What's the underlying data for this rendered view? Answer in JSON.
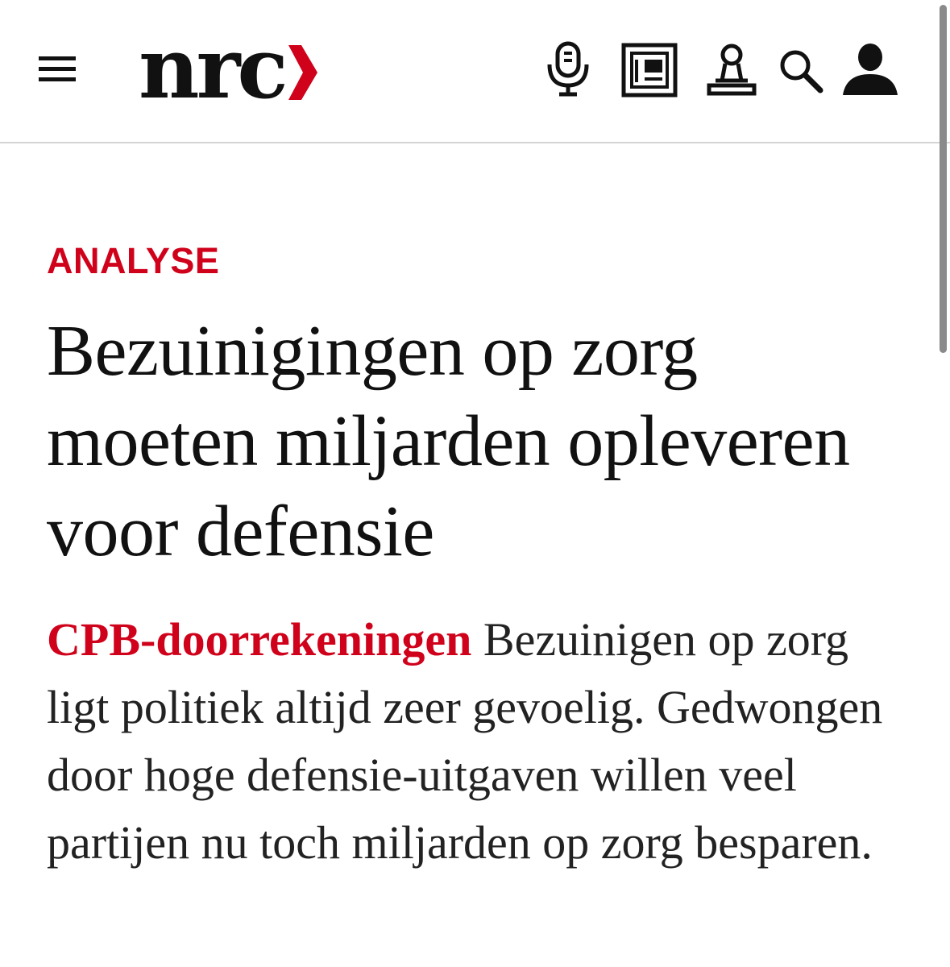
{
  "header": {
    "logo_text": "nrc",
    "menu_icon": "hamburger-menu-icon",
    "icons": [
      "microphone-icon",
      "newspaper-icon",
      "chess-pawn-icon",
      "search-icon",
      "user-icon"
    ],
    "brand_color": "#d0021b"
  },
  "article": {
    "kicker": "ANALYSE",
    "headline": "Bezuinigingen op zorg moeten miljarden opleveren voor defensie",
    "lead_label": "CPB-doorrekeningen",
    "lead_text": "Bezuinigen op zorg ligt politiek altijd zeer gevoelig. Gedwongen door hoge defensie-uitgaven willen veel partijen nu toch miljarden op zorg besparen."
  }
}
